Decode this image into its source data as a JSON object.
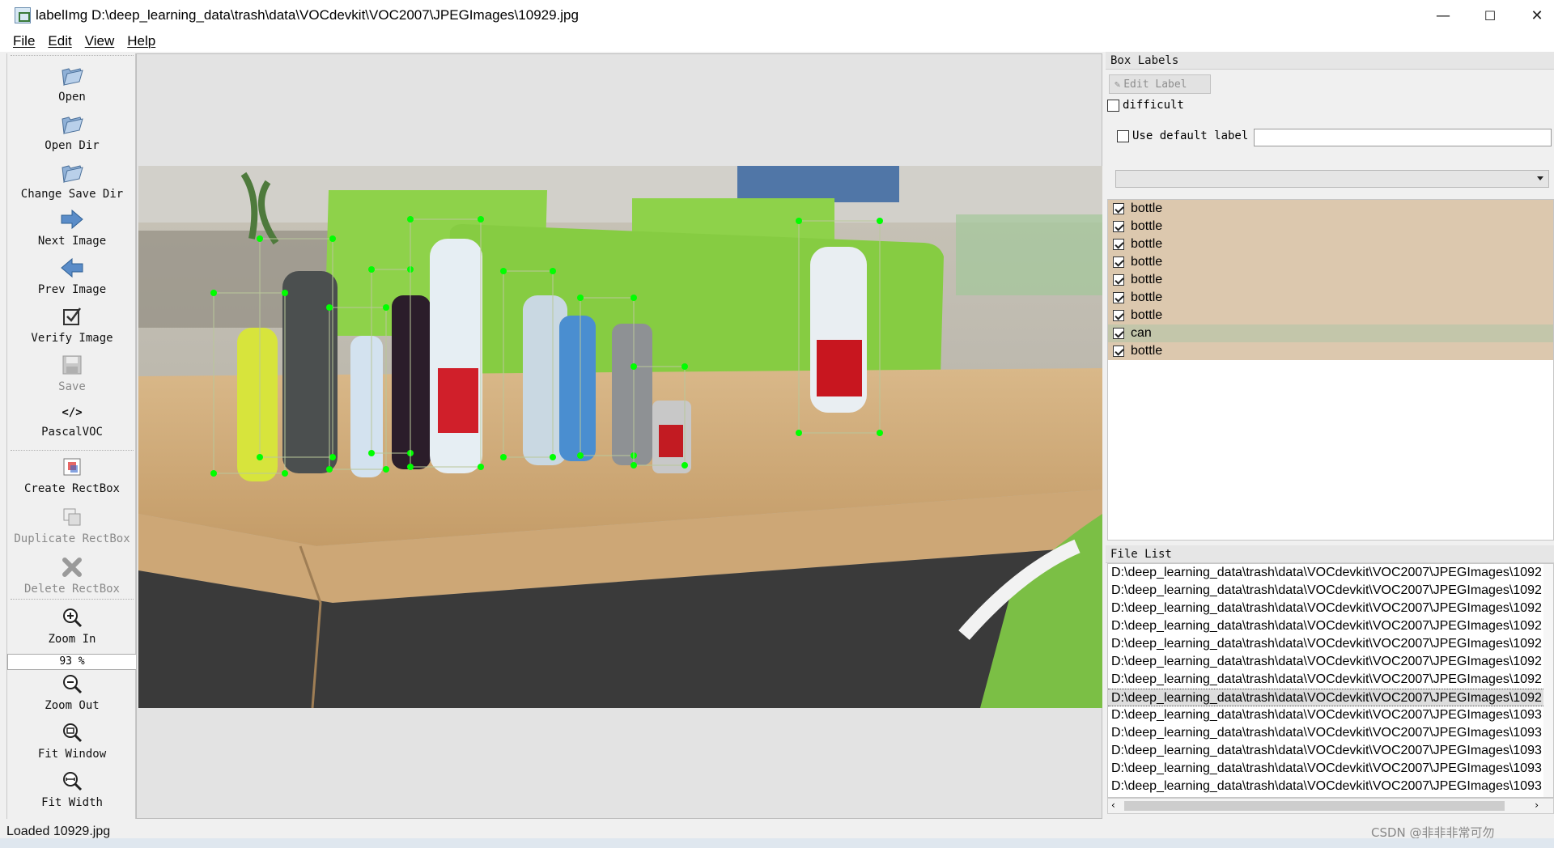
{
  "window": {
    "title": "labelImg D:\\deep_learning_data\\trash\\data\\VOCdevkit\\VOC2007\\JPEGImages\\10929.jpg",
    "minimize": "—",
    "maximize": "☐",
    "close": "✕"
  },
  "menu": [
    "File",
    "Edit",
    "View",
    "Help"
  ],
  "toolbar": {
    "open": "Open",
    "open_dir": "Open Dir",
    "change_save_dir": "Change Save Dir",
    "next_image": "Next Image",
    "prev_image": "Prev Image",
    "verify_image": "Verify Image",
    "save": "Save",
    "format_icon": "</>",
    "format": "PascalVOC",
    "create_rectbox": "Create RectBox",
    "duplicate_rectbox": "Duplicate RectBox",
    "delete_rectbox": "Delete RectBox",
    "zoom_in": "Zoom In",
    "zoom_value": "93 %",
    "zoom_out": "Zoom Out",
    "fit_window": "Fit Window",
    "fit_width": "Fit Width"
  },
  "box_labels": {
    "title": "Box Labels",
    "edit_label": "Edit Label",
    "difficult": "difficult",
    "use_default_label": "Use default label",
    "default_label_value": "",
    "items": [
      {
        "label": "bottle",
        "checked": true,
        "selected": false
      },
      {
        "label": "bottle",
        "checked": true,
        "selected": false
      },
      {
        "label": "bottle",
        "checked": true,
        "selected": false
      },
      {
        "label": "bottle",
        "checked": true,
        "selected": false
      },
      {
        "label": "bottle",
        "checked": true,
        "selected": false
      },
      {
        "label": "bottle",
        "checked": true,
        "selected": false
      },
      {
        "label": "bottle",
        "checked": true,
        "selected": false
      },
      {
        "label": "can",
        "checked": true,
        "selected": true
      },
      {
        "label": "bottle",
        "checked": true,
        "selected": false
      }
    ]
  },
  "file_list": {
    "title": "File List",
    "items": [
      "D:\\deep_learning_data\\trash\\data\\VOCdevkit\\VOC2007\\JPEGImages\\1092",
      "D:\\deep_learning_data\\trash\\data\\VOCdevkit\\VOC2007\\JPEGImages\\1092",
      "D:\\deep_learning_data\\trash\\data\\VOCdevkit\\VOC2007\\JPEGImages\\1092",
      "D:\\deep_learning_data\\trash\\data\\VOCdevkit\\VOC2007\\JPEGImages\\1092",
      "D:\\deep_learning_data\\trash\\data\\VOCdevkit\\VOC2007\\JPEGImages\\1092",
      "D:\\deep_learning_data\\trash\\data\\VOCdevkit\\VOC2007\\JPEGImages\\1092",
      "D:\\deep_learning_data\\trash\\data\\VOCdevkit\\VOC2007\\JPEGImages\\1092",
      "D:\\deep_learning_data\\trash\\data\\VOCdevkit\\VOC2007\\JPEGImages\\1092",
      "D:\\deep_learning_data\\trash\\data\\VOCdevkit\\VOC2007\\JPEGImages\\1093",
      "D:\\deep_learning_data\\trash\\data\\VOCdevkit\\VOC2007\\JPEGImages\\1093",
      "D:\\deep_learning_data\\trash\\data\\VOCdevkit\\VOC2007\\JPEGImages\\1093",
      "D:\\deep_learning_data\\trash\\data\\VOCdevkit\\VOC2007\\JPEGImages\\1093",
      "D:\\deep_learning_data\\trash\\data\\VOCdevkit\\VOC2007\\JPEGImages\\1093"
    ],
    "active_index": 7
  },
  "status": "Loaded 10929.jpg",
  "watermark": "CSDN @非非非常可勿",
  "colors": {
    "box_label_row": "#dcc8ae",
    "box_label_selected": "#c3c6aa",
    "annotation_box": "#00ff00",
    "desk_partition": "#8ed24a"
  }
}
